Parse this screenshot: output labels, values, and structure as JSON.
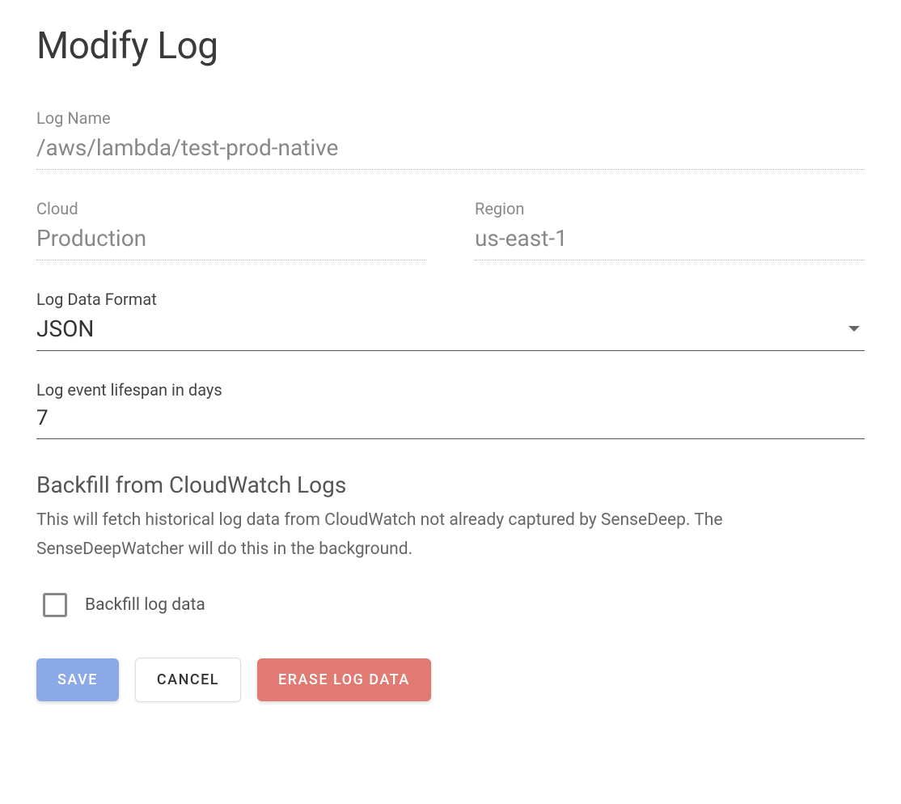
{
  "title": "Modify Log",
  "fields": {
    "logName": {
      "label": "Log Name",
      "value": "/aws/lambda/test-prod-native"
    },
    "cloud": {
      "label": "Cloud",
      "value": "Production"
    },
    "region": {
      "label": "Region",
      "value": "us-east-1"
    },
    "format": {
      "label": "Log Data Format",
      "value": "JSON"
    },
    "lifespan": {
      "label": "Log event lifespan in days",
      "value": "7"
    }
  },
  "backfill": {
    "title": "Backfill from CloudWatch Logs",
    "description": "This will fetch historical log data from CloudWatch not already captured by SenseDeep. The SenseDeepWatcher will do this in the background.",
    "checkboxLabel": "Backfill log data",
    "checked": false
  },
  "buttons": {
    "save": "Save",
    "cancel": "Cancel",
    "erase": "Erase Log Data"
  }
}
